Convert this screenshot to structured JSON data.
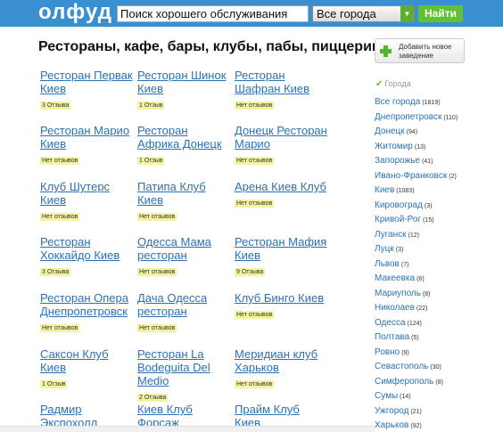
{
  "header": {
    "logo": "олфуд",
    "search_value": "Поиск хорошего обслуживания",
    "city_select": "Все города",
    "find_button": "Найти"
  },
  "main": {
    "title": "Рестораны, кафе, бары, клубы, пабы, пиццерии",
    "cards": [
      {
        "title": "Ресторан Первак Киев",
        "badge": "3 Отзыва"
      },
      {
        "title": "Ресторан Шинок Киев",
        "badge": "1 Отзыв"
      },
      {
        "title": "Ресторан Шафран Киев",
        "badge": "Нет отзывов"
      },
      {
        "title": "Ресторан Марио Киев",
        "badge": "Нет отзывов"
      },
      {
        "title": "Ресторан Африка Донецк",
        "badge": "1 Отзыв"
      },
      {
        "title": "Донецк Ресторан Марио",
        "badge": "Нет отзывов"
      },
      {
        "title": "Клуб Шутерс Киев",
        "badge": "Нет отзывов"
      },
      {
        "title": "Патипа Клуб Киев",
        "badge": "Нет отзывов"
      },
      {
        "title": "Арена Киев Клуб",
        "badge": "Нет отзывов"
      },
      {
        "title": "Ресторан Хоккайдо Киев",
        "badge": "3 Отзыва"
      },
      {
        "title": "Одесса Мама ресторан",
        "badge": "Нет отзывов"
      },
      {
        "title": "Ресторан Мафия Киев",
        "badge": "9 Отзыва"
      },
      {
        "title": "Ресторан Опера Днепропетровск",
        "badge": "Нет отзывов"
      },
      {
        "title": "Дача Одесса ресторан",
        "badge": "Нет отзывов"
      },
      {
        "title": "Клуб Бинго Киев",
        "badge": "Нет отзывов"
      },
      {
        "title": "Саксон Клуб Киев",
        "badge": "1 Отзыв"
      },
      {
        "title": "Ресторан La Bodeguita Del Medio",
        "badge": "2 Отзыва"
      },
      {
        "title": "Меридиан клуб Харьков",
        "badge": "Нет отзывов"
      },
      {
        "title": "Радмир Экспохолл",
        "badge": ""
      },
      {
        "title": "Киев Клуб Форсаж",
        "badge": ""
      },
      {
        "title": "Прайм Клуб Киев",
        "badge": ""
      }
    ]
  },
  "sidebar": {
    "add_button": "Добавить новое заведение",
    "cities_header": "Города",
    "cities": [
      {
        "name": "Все города",
        "count": "(1819)"
      },
      {
        "name": "Днепропетровск",
        "count": "(110)"
      },
      {
        "name": "Донецк",
        "count": "(94)"
      },
      {
        "name": "Житомир",
        "count": "(13)"
      },
      {
        "name": "Запорожье",
        "count": "(41)"
      },
      {
        "name": "Ивано-Франковск",
        "count": "(2)"
      },
      {
        "name": "Киев",
        "count": "(1083)"
      },
      {
        "name": "Кировоград",
        "count": "(3)"
      },
      {
        "name": "Кривой-Рог",
        "count": "(15)"
      },
      {
        "name": "Луганск",
        "count": "(12)"
      },
      {
        "name": "Луцк",
        "count": "(3)"
      },
      {
        "name": "Львов",
        "count": "(7)"
      },
      {
        "name": "Макеевка",
        "count": "(6)"
      },
      {
        "name": "Мариуполь",
        "count": "(8)"
      },
      {
        "name": "Николаев",
        "count": "(22)"
      },
      {
        "name": "Одесса",
        "count": "(124)"
      },
      {
        "name": "Полтава",
        "count": "(5)"
      },
      {
        "name": "Ровно",
        "count": "(9)"
      },
      {
        "name": "Севастополь",
        "count": "(30)"
      },
      {
        "name": "Симферополь",
        "count": "(8)"
      },
      {
        "name": "Сумы",
        "count": "(14)"
      },
      {
        "name": "Ужгород",
        "count": "(21)"
      },
      {
        "name": "Харьков",
        "count": "(92)"
      }
    ]
  }
}
